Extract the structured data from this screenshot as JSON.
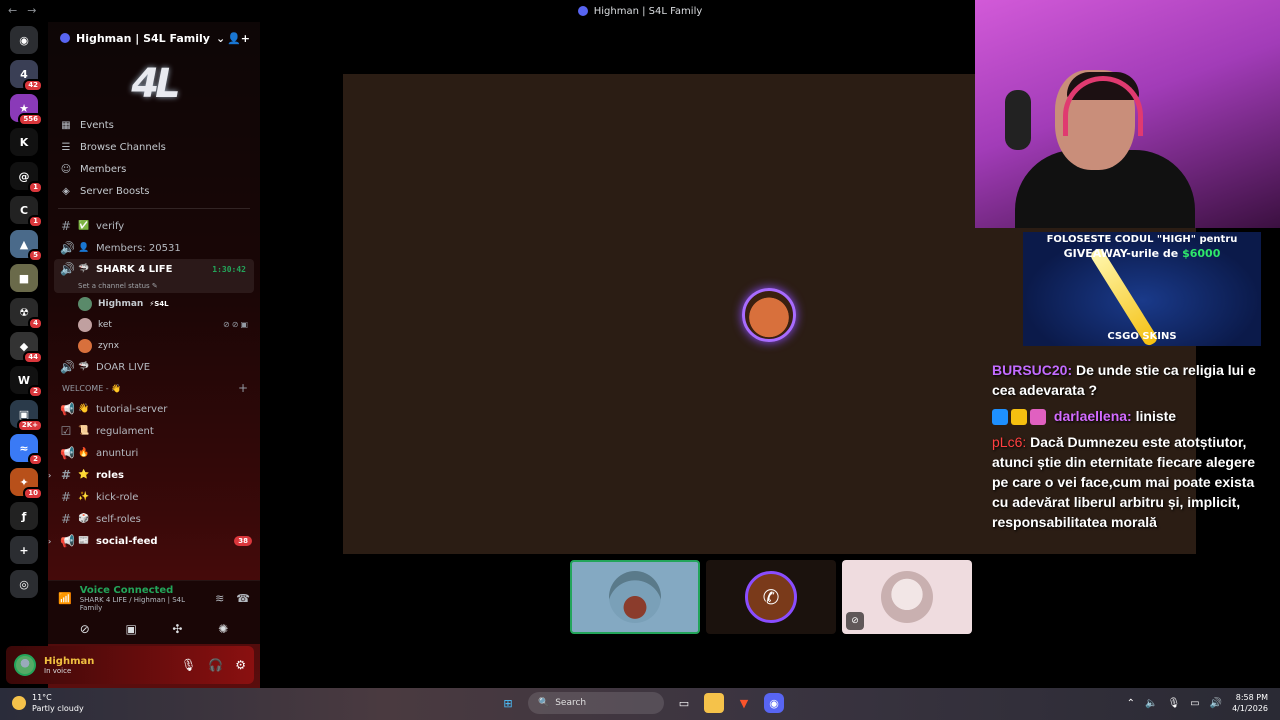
{
  "window": {
    "title": "Highman | S4L Family",
    "nav_back": "←",
    "nav_forward": "→"
  },
  "rail": {
    "items": [
      {
        "name": "discord-home",
        "glyph": "◉",
        "color": "#2b2d31",
        "badge": ""
      },
      {
        "name": "server-s4l",
        "glyph": "4",
        "color": "#3a3f55",
        "badge": "42"
      },
      {
        "name": "server-2",
        "glyph": "★",
        "color": "#8a3ab8",
        "badge": "556"
      },
      {
        "name": "server-kick",
        "glyph": "K",
        "color": "#111",
        "badge": ""
      },
      {
        "name": "server-spiral",
        "glyph": "@",
        "color": "#111",
        "badge": "1"
      },
      {
        "name": "server-csgo",
        "glyph": "C",
        "color": "#222",
        "badge": "1"
      },
      {
        "name": "server-5",
        "glyph": "▲",
        "color": "#4a6a8a",
        "badge": "5"
      },
      {
        "name": "server-6",
        "glyph": "■",
        "color": "#6a6a4a",
        "badge": ""
      },
      {
        "name": "server-7",
        "glyph": "☢",
        "color": "#2a2a2a",
        "badge": "4"
      },
      {
        "name": "server-8",
        "glyph": "◆",
        "color": "#333",
        "badge": "44"
      },
      {
        "name": "server-w",
        "glyph": "W",
        "color": "#111",
        "badge": "2"
      },
      {
        "name": "server-10",
        "glyph": "▣",
        "color": "#2a3a4a",
        "badge": "2K+"
      },
      {
        "name": "server-11",
        "glyph": "≈",
        "color": "#3a7af5",
        "badge": "2"
      },
      {
        "name": "server-12",
        "glyph": "✦",
        "color": "#b8501a",
        "badge": "10"
      },
      {
        "name": "server-13",
        "glyph": "ƒ",
        "color": "#222",
        "badge": ""
      },
      {
        "name": "add-server",
        "glyph": "+",
        "color": "#2b2d31",
        "badge": ""
      },
      {
        "name": "discover",
        "glyph": "◎",
        "color": "#2b2d31",
        "badge": ""
      }
    ]
  },
  "server": {
    "name": "Highman | S4L Family",
    "banner_text": "4L",
    "menu": [
      {
        "icon": "▦",
        "label": "Events",
        "name": "events"
      },
      {
        "icon": "☰",
        "label": "Browse Channels",
        "name": "browse-channels"
      },
      {
        "icon": "☺",
        "label": "Members",
        "name": "members"
      },
      {
        "icon": "◈",
        "label": "Server Boosts",
        "name": "server-boosts"
      }
    ]
  },
  "channels": {
    "verify": {
      "icon": "#",
      "emo": "✅",
      "label": "verify"
    },
    "members": {
      "icon": "🔊",
      "emo": "👤",
      "label": "Members: 20531"
    },
    "shark": {
      "icon": "🔊",
      "emo": "🦈",
      "label": "SHARK 4 LIFE",
      "time": "1:30:42",
      "status": "Set a channel status ✎"
    },
    "voice_users": [
      {
        "name": "Highman",
        "tag": "⚡S4L",
        "color": "#5a8a6a",
        "icons": ""
      },
      {
        "name": "ket",
        "tag": "",
        "color": "#c0a0a0",
        "icons": "⊘⊘▣"
      },
      {
        "name": "zynx",
        "tag": "",
        "color": "#d8703c",
        "icons": ""
      }
    ],
    "doar": {
      "icon": "🔊",
      "emo": "🦈",
      "label": "DOAR LIVE"
    },
    "category": {
      "label": "WELCOME - 👋",
      "plus": "+"
    },
    "list": [
      {
        "icon": "📢",
        "emo": "👋",
        "label": "tutorial-server",
        "bold": false,
        "count": "",
        "caret": false
      },
      {
        "icon": "☑",
        "emo": "📜",
        "label": "regulament",
        "bold": false,
        "count": "",
        "caret": false
      },
      {
        "icon": "📢",
        "emo": "🔥",
        "label": "anunturi",
        "bold": false,
        "count": "",
        "caret": false
      },
      {
        "icon": "#",
        "emo": "⭐",
        "label": "roles",
        "bold": true,
        "count": "",
        "caret": true
      },
      {
        "icon": "#",
        "emo": "✨",
        "label": "kick-role",
        "bold": false,
        "count": "",
        "caret": false
      },
      {
        "icon": "#",
        "emo": "🎲",
        "label": "self-roles",
        "bold": false,
        "count": "",
        "caret": false
      },
      {
        "icon": "📢",
        "emo": "📰",
        "label": "social-feed",
        "bold": true,
        "count": "38",
        "caret": true
      }
    ]
  },
  "voice_panel": {
    "status": "Voice Connected",
    "location": "SHARK 4 LIFE / Highman | S4L Family"
  },
  "user_panel": {
    "name": "Highman",
    "status": "In voice"
  },
  "overlay": {
    "sponsor_line1": "FOLOSESTE CODUL \"HIGH\" pentru",
    "sponsor_line2a": "GIVEAWAY-urile de ",
    "sponsor_amount": "$6000",
    "sponsor_brand": "CSGO SKINS"
  },
  "chat": [
    {
      "user": "BURSUC20:",
      "text": "De unde stie ca religia lui e cea adevarata ?"
    },
    {
      "user": "darlaellena:",
      "text": "liniste"
    },
    {
      "user": "pLc6:",
      "text": "Dacă Dumnezeu este atotștiutor, atunci știe din eternitate fiecare alegere pe care o vei face,cum mai poate exista cu adevărat liberul arbitru și, implicit, responsabilitatea morală"
    }
  ],
  "taskbar": {
    "temp": "11°C",
    "weather": "Partly cloudy",
    "search_placeholder": "Search",
    "time": "8:58 PM",
    "date": "4/1/2026"
  }
}
